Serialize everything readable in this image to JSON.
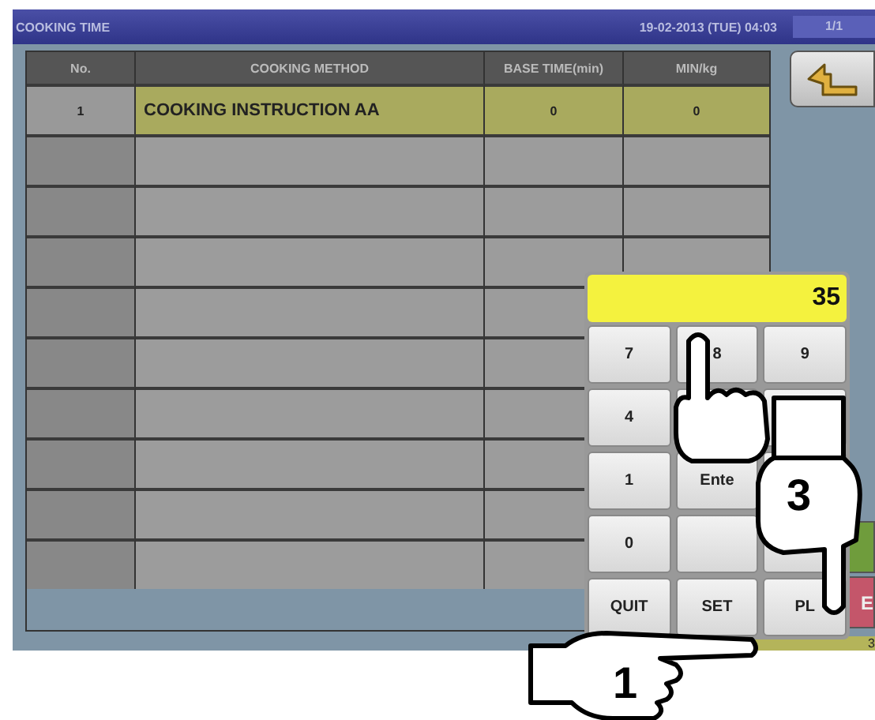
{
  "title_bar": {
    "title": "COOKING TIME",
    "datetime": "19-02-2013 (TUE) 04:03",
    "page": "1/1"
  },
  "table": {
    "columns": [
      "No.",
      "COOKING METHOD",
      "BASE TIME(min)",
      "MIN/kg"
    ],
    "rows": [
      {
        "no": "1",
        "method": "COOKING INSTRUCTION AA",
        "base_time": "0",
        "min_kg": "0",
        "selected": true
      },
      {
        "selected": false
      },
      {
        "selected": false
      },
      {
        "selected": false
      },
      {
        "selected": false
      },
      {
        "selected": false
      },
      {
        "selected": false
      },
      {
        "selected": false
      },
      {
        "selected": false
      },
      {
        "selected": false
      }
    ]
  },
  "side_buttons": [
    {
      "color": "#6f9c3c"
    },
    {
      "color": "#c4566a",
      "label": "E"
    }
  ],
  "bottom_bar": {
    "text": "3"
  },
  "keypad": {
    "display": "35",
    "rows": [
      {
        "keys": [
          "7",
          "8",
          "9"
        ]
      },
      {
        "keys": [
          "4"
        ]
      },
      {
        "keys": [
          "1",
          "Ente"
        ]
      },
      {
        "keys": [
          "0"
        ]
      },
      {
        "keys": [
          "QUIT",
          "SET",
          "PL"
        ]
      }
    ]
  },
  "hands": [
    {
      "kind": "up"
    },
    {
      "kind": "down",
      "step": "3"
    },
    {
      "kind": "right",
      "step": "1"
    }
  ]
}
